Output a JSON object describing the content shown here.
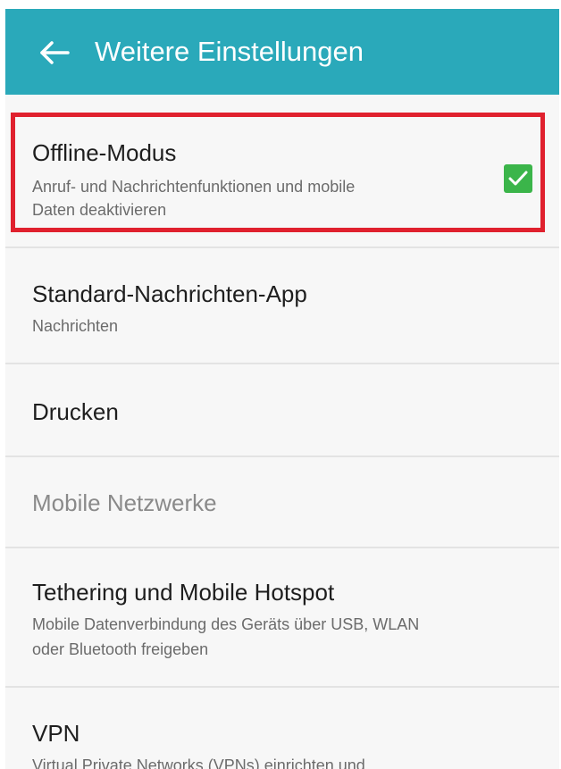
{
  "header": {
    "title": "Weitere Einstellungen",
    "back_icon": "arrow-left-icon",
    "background": "#2aa9ba"
  },
  "items": [
    {
      "title": "Offline-Modus",
      "subtitle_line1": "Anruf- und Nachrichtenfunktionen und mobile",
      "subtitle_line2": "Daten deaktivieren",
      "checked": true,
      "highlighted": true
    },
    {
      "title": "Standard-Nachrichten-App",
      "subtitle_line1": "Nachrichten"
    },
    {
      "title": "Drucken"
    },
    {
      "title": "Mobile Netzwerke",
      "disabled": true
    },
    {
      "title": "Tethering und Mobile Hotspot",
      "subtitle_line1": "Mobile Datenverbindung des Geräts über USB, WLAN",
      "subtitle_line2": "oder Bluetooth freigeben"
    },
    {
      "title": "VPN",
      "subtitle_line1": "Virtual Private Networks (VPNs) einrichten und"
    }
  ],
  "colors": {
    "accent": "#2aa9ba",
    "checkbox": "#3bb54a",
    "highlight_border": "#e0212e"
  }
}
